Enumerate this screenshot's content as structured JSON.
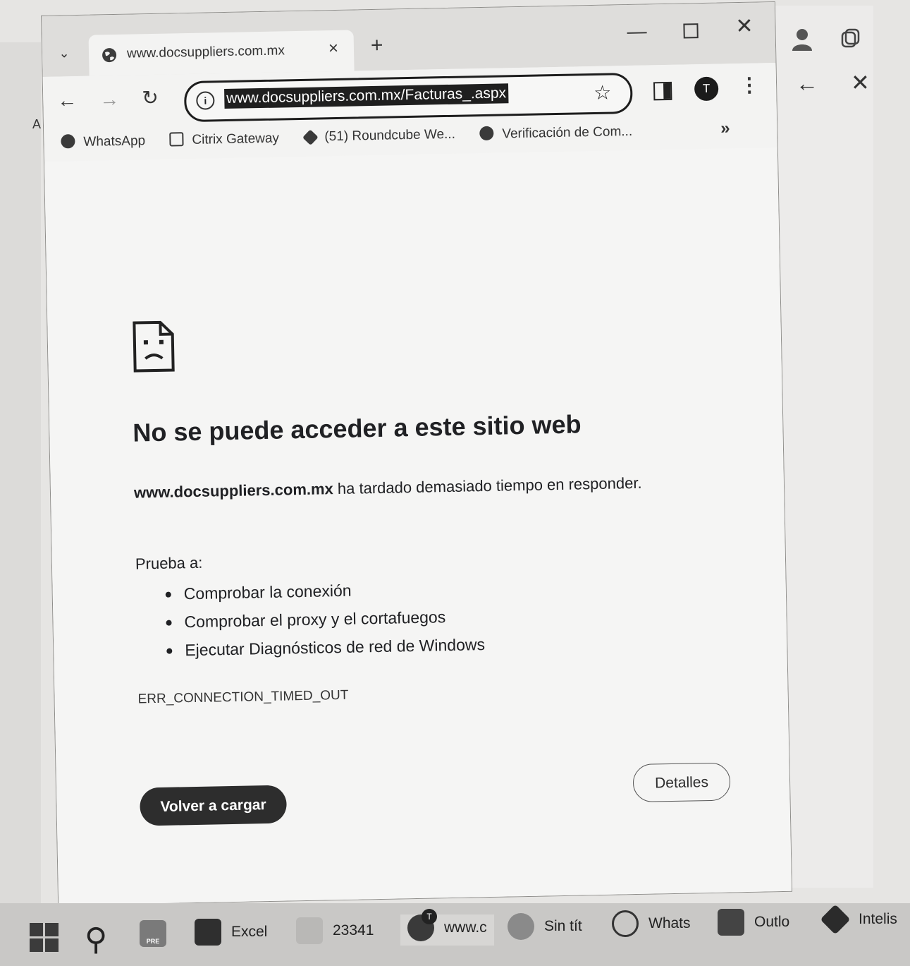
{
  "right_panel": {
    "back": "←",
    "close": "✕"
  },
  "left_strip": {
    "letter": "A"
  },
  "browser": {
    "tab": {
      "title": "www.docsuppliers.com.mx",
      "close": "×"
    },
    "new_tab": "+",
    "window_controls": {
      "minimize": "—",
      "close": "✕"
    },
    "nav": {
      "back": "←",
      "forward": "→",
      "reload": "↻"
    },
    "address": {
      "url": "www.docsuppliers.com.mx/Facturas_.aspx",
      "info": "i",
      "star": "☆"
    },
    "profile_letter": "T",
    "menu": "⋮",
    "bookmarks": [
      {
        "label": "WhatsApp"
      },
      {
        "label": "Citrix Gateway"
      },
      {
        "label": "(51) Roundcube We..."
      },
      {
        "label": "Verificación de Com..."
      }
    ],
    "bookmarks_more": "»"
  },
  "error_page": {
    "title": "No se puede acceder a este sitio web",
    "host": "www.docsuppliers.com.mx",
    "message": " ha tardado demasiado tiempo en responder.",
    "try_label": "Prueba a:",
    "suggestions": [
      "Comprobar la conexión",
      "Comprobar el proxy y el cortafuegos",
      "Ejecutar Diagnósticos de red de Windows"
    ],
    "error_code": "ERR_CONNECTION_TIMED_OUT",
    "reload_label": "Volver a cargar",
    "details_label": "Detalles"
  },
  "taskbar": {
    "items": [
      {
        "label": "Excel"
      },
      {
        "label": "23341"
      },
      {
        "label": "www.c"
      },
      {
        "label": "Sin tít"
      },
      {
        "label": "Whats"
      },
      {
        "label": "Outlo"
      },
      {
        "label": "Intelis"
      }
    ],
    "badge": "T",
    "pre_label": "PRE"
  },
  "colors": {
    "accent_dark": "#2d2d2d",
    "page_bg": "#f5f5f4"
  }
}
